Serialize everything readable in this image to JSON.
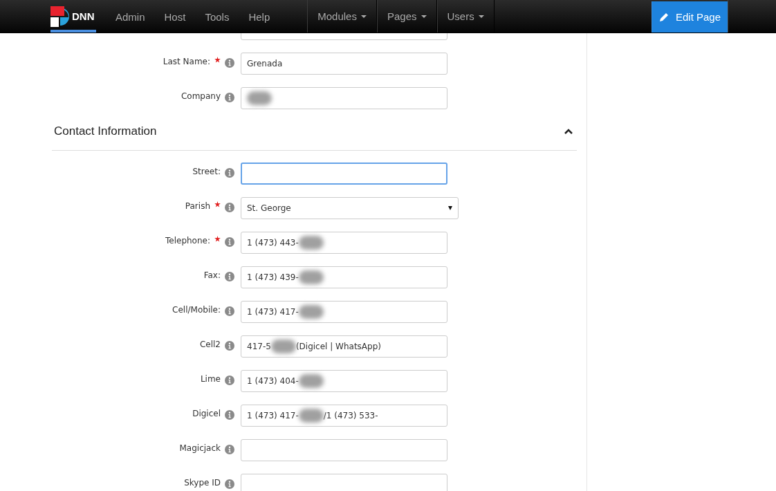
{
  "navbar": {
    "logo": "DNN",
    "links": [
      {
        "label": "Admin"
      },
      {
        "label": "Host"
      },
      {
        "label": "Tools"
      },
      {
        "label": "Help"
      }
    ],
    "menus": [
      {
        "label": "Modules"
      },
      {
        "label": "Pages"
      },
      {
        "label": "Users"
      }
    ],
    "edit_button": "Edit Page"
  },
  "top_fields": [
    {
      "kind": "text"
    },
    {
      "kind": "text",
      "label": "Last Name:",
      "required": true,
      "value": "Grenada"
    },
    {
      "kind": "text",
      "label": "Company",
      "required": false,
      "redacted": true
    }
  ],
  "section": {
    "title": "Contact Information",
    "expanded": true
  },
  "fields": [
    {
      "kind": "text",
      "label": "Street:",
      "required": false,
      "focused": true
    },
    {
      "kind": "select",
      "label": "Parish",
      "required": true,
      "value": "St. George"
    },
    {
      "kind": "text",
      "label": "Telephone:",
      "required": true,
      "value": "1 (473) 443-",
      "redacted": true
    },
    {
      "kind": "text",
      "label": "Fax:",
      "required": false,
      "value": "1 (473) 439-",
      "redacted": true
    },
    {
      "kind": "text",
      "label": "Cell/Mobile:",
      "required": false,
      "value": "1 (473) 417-",
      "redacted": true
    },
    {
      "kind": "text",
      "label": "Cell2",
      "required": false,
      "value": "417-5",
      "suffix": "(Digicel | WhatsApp)",
      "redacted": true
    },
    {
      "kind": "text",
      "label": "Lime",
      "required": false,
      "value": "1 (473) 404-",
      "redacted": true
    },
    {
      "kind": "text",
      "label": "Digicel",
      "required": false,
      "value": "1 (473) 417-",
      "suffix": "/1 (473) 533-",
      "redacted": true
    },
    {
      "kind": "text",
      "label": "Magicjack",
      "required": false
    },
    {
      "kind": "text",
      "label": "Skype ID",
      "required": false
    }
  ]
}
